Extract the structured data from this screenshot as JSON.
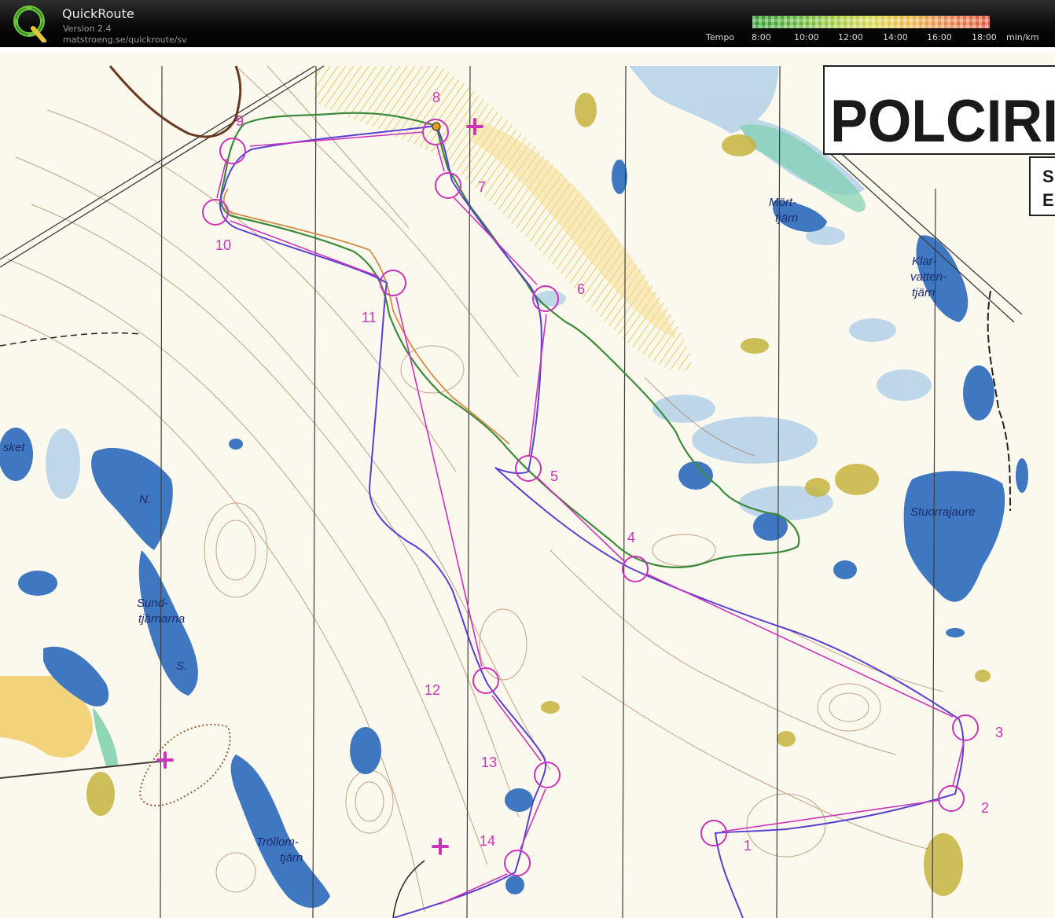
{
  "app": {
    "name": "QuickRoute",
    "version": "Version 2.4",
    "url": "matstroeng.se/quickroute/sv"
  },
  "tempo": {
    "label": "Tempo",
    "ticks": [
      "8:00",
      "10:00",
      "12:00",
      "14:00",
      "16:00",
      "18:00"
    ],
    "unit": "min/km"
  },
  "map": {
    "title_fragment": "POLCIRI",
    "side_letters": [
      "S",
      "E"
    ],
    "place_names": {
      "mort_1": "Mört-",
      "mort_2": "tjärn",
      "klar_1": "Klar-",
      "klar_2": "vatten-",
      "klar_3": "tjärn",
      "stuorrajaure": "Stuorrajaure",
      "sket": "sket",
      "n": "N.",
      "sund_1": "Sund-",
      "sund_2": "tjärnarna",
      "s": "S.",
      "troll_1": "Tröllom-",
      "troll_2": "tjärn"
    },
    "controls": [
      "1",
      "2",
      "3",
      "4",
      "5",
      "6",
      "7",
      "8",
      "9",
      "10",
      "11",
      "12",
      "13",
      "14"
    ],
    "colors": {
      "course": "#cc33bb",
      "route_purple": "#5a3fd0",
      "route_green": "#3a8a3a",
      "route_orange": "#d08030",
      "water": "#3f78c0",
      "marsh": "#a9cde8",
      "open_yellow": "#f2d27a",
      "contour": "#9a5a2e"
    }
  }
}
